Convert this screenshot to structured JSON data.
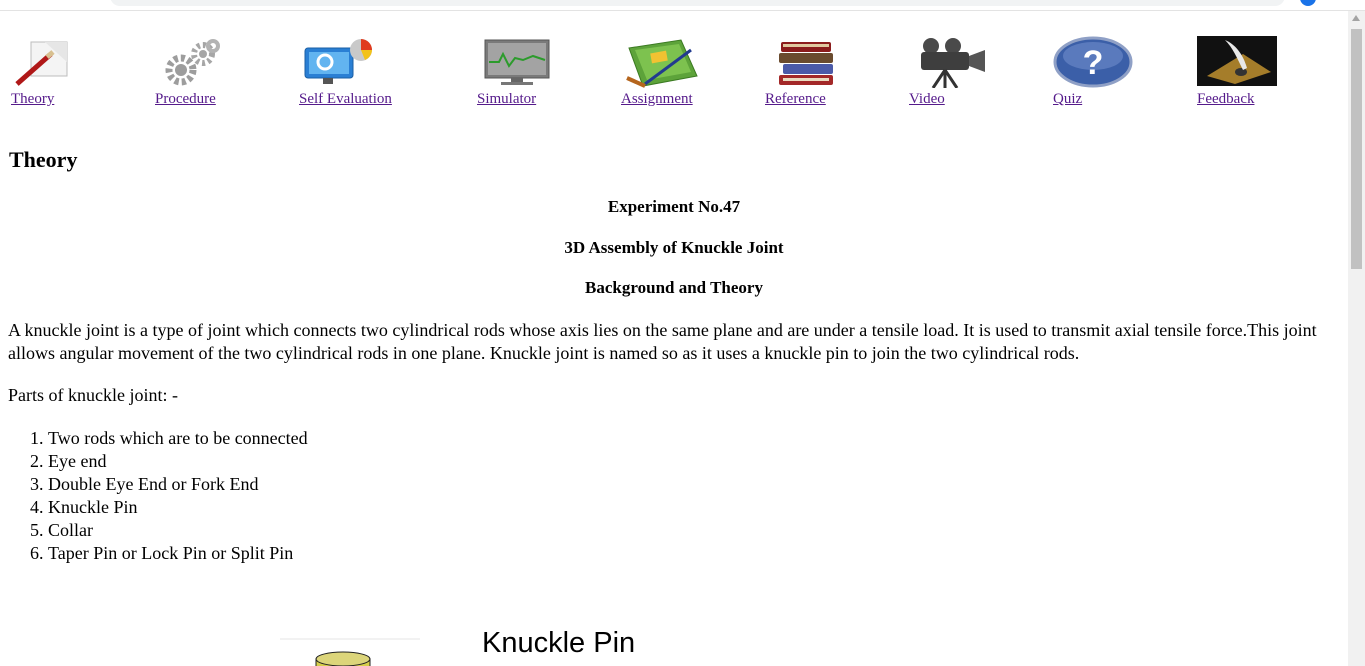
{
  "nav": [
    {
      "label": "Theory",
      "icon": "theory-icon"
    },
    {
      "label": "Procedure",
      "icon": "gears-icon"
    },
    {
      "label": "Self Evaluation",
      "icon": "self-evaluation-icon"
    },
    {
      "label": "Simulator",
      "icon": "monitor-icon"
    },
    {
      "label": "Assignment",
      "icon": "assignment-icon"
    },
    {
      "label": "Reference",
      "icon": "books-icon"
    },
    {
      "label": "Video",
      "icon": "video-camera-icon"
    },
    {
      "label": "Quiz",
      "icon": "question-icon"
    },
    {
      "label": "Feedback",
      "icon": "quill-icon"
    }
  ],
  "page": {
    "title": "Theory",
    "experiment": "Experiment No.47",
    "subtitle": "3D Assembly of Knuckle Joint",
    "section": "Background and Theory",
    "intro": "A knuckle joint is a type of joint which connects two cylindrical rods whose axis lies on the same plane and are under a tensile load. It is used to transmit axial tensile force.This joint allows angular movement of the two cylindrical rods in one plane. Knuckle joint is named so as it uses a knuckle pin to join the two cylindrical rods.",
    "parts_heading": "Parts of knuckle joint: -",
    "parts": [
      "Two rods which are to be connected",
      "Eye end",
      "Double Eye End or Fork End",
      "Knuckle Pin",
      "Collar",
      "Taper Pin or Lock Pin or Split Pin"
    ]
  },
  "figure": {
    "caption": "Knuckle Pin"
  }
}
